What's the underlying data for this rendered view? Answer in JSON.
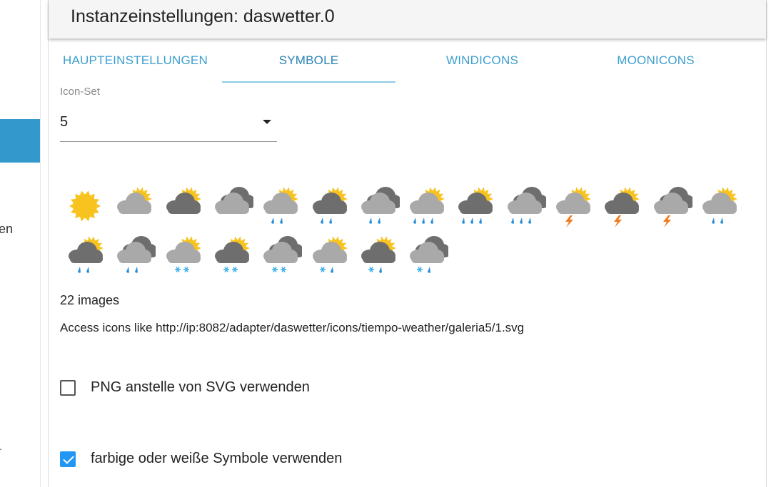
{
  "sidebar": {
    "fragment_text": "en",
    "fragment_mark": "."
  },
  "dialog": {
    "title": "Instanzeinstellungen: daswetter.0"
  },
  "tabs": [
    {
      "label": "HAUPTEINSTELLUNGEN",
      "active": false
    },
    {
      "label": "SYMBOLE",
      "active": true
    },
    {
      "label": "WINDICONS",
      "active": false
    },
    {
      "label": "MOONICONS",
      "active": false
    }
  ],
  "icon_set": {
    "label": "Icon-Set",
    "value": "5"
  },
  "weather_icons": [
    "sun-icon",
    "sun-light-cloud-icon",
    "sun-dark-cloud-icon",
    "clouds-icon",
    "sun-cloud-light-rain-icon",
    "sun-dark-cloud-light-rain-icon",
    "clouds-light-rain-icon",
    "sun-cloud-rain-icon",
    "sun-dark-cloud-rain-icon",
    "clouds-rain-icon",
    "sun-cloud-thunder-icon",
    "sun-dark-cloud-thunder-icon",
    "clouds-thunder-icon",
    "sun-cloud-drizzle-icon",
    "sun-dark-cloud-drizzle-icon",
    "clouds-drizzle-icon",
    "sun-cloud-snow-icon",
    "sun-dark-cloud-snow-icon",
    "clouds-snow-icon",
    "sun-cloud-sleet-icon",
    "sun-dark-cloud-sleet-icon",
    "clouds-sleet-icon"
  ],
  "images_count_text": "22 images",
  "access_text": "Access icons like http://ip:8082/adapter/daswetter/icons/tiempo-weather/galeria5/1.svg",
  "options": [
    {
      "label": "PNG anstelle von SVG verwenden",
      "checked": false
    },
    {
      "label": "farbige oder weiße Symbole verwenden",
      "checked": true
    }
  ],
  "colors": {
    "accent": "#3399cc",
    "tab_text": "#3c9fcf",
    "checkbox_checked": "#2196f3",
    "sun": "#f9c31f",
    "cloud_light": "#a9a9a9",
    "cloud_dark": "#6e6e6e",
    "rain": "#2a8fd6",
    "thunder": "#f07a1a",
    "snow": "#3fb0e8"
  }
}
